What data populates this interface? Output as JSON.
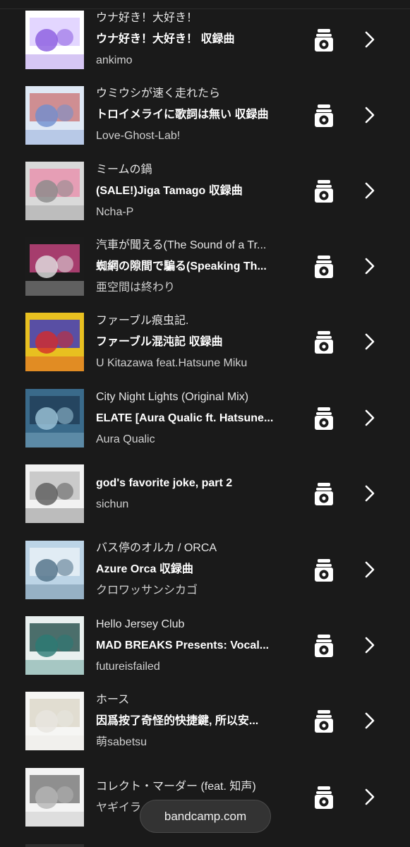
{
  "app": {
    "brand_pill": "bandcamp.com"
  },
  "feed": {
    "items": [
      {
        "title": "ウナ好き！大好き！",
        "album": "ウナ好き！大好き！ 収録曲",
        "artist": "ankimo",
        "art_colors": [
          "#ffffff",
          "#8a5be0",
          "#d9c8ff"
        ],
        "icon": "wishlist-icon"
      },
      {
        "title": "ウミウシが速く走れたら",
        "album": "トロイメライに歌詞は無い 収録曲",
        "artist": "Love-Ghost-Lab!",
        "art_colors": [
          "#dfe8f5",
          "#6f8fcf",
          "#c97070"
        ],
        "icon": "wishlist-icon"
      },
      {
        "title": "ミームの鍋",
        "album": "(SALE!)Jiga Tamago 収録曲",
        "artist": "Ncha-P",
        "art_colors": [
          "#d9d9d9",
          "#8a8a8a",
          "#e98aa8"
        ],
        "icon": "wishlist-icon"
      },
      {
        "title": "汽車が聞える(The Sound of a Tr...",
        "album": "蜘網の隙間で騙る(Speaking Th...",
        "artist": "亜空間は終わり",
        "art_colors": [
          "#1b1b1b",
          "#e2e2e2",
          "#d64a8a"
        ],
        "icon": "wishlist-icon"
      },
      {
        "title": "ファーブル痕虫記.",
        "album": "ファーブル混沌記 収録曲",
        "artist": "U Kitazawa feat.Hatsune Miku",
        "art_colors": [
          "#e8c020",
          "#d42a2a",
          "#2a2ad0"
        ],
        "icon": "wishlist-icon"
      },
      {
        "title": "City Night Lights (Original Mix)",
        "album": "ELATE [Aura Qualic ft. Hatsune...",
        "artist": "Aura Qualic",
        "art_colors": [
          "#3a6a8a",
          "#9fc6da",
          "#1f3a52"
        ],
        "icon": "wishlist-icon"
      },
      {
        "title": "",
        "album": "god's favorite joke, part 2",
        "artist": "sichun",
        "art_colors": [
          "#f2f2f2",
          "#5a5a5a",
          "#bcbcbc"
        ],
        "icon": "wishlist-icon"
      },
      {
        "title": "バス停のオルカ / ORCA",
        "album": "Azure Orca 収録曲",
        "artist": "クロワッサンシカゴ",
        "art_colors": [
          "#bcd4e6",
          "#4f6f86",
          "#eef4f8"
        ],
        "icon": "wishlist-icon"
      },
      {
        "title": "Hello Jersey Club",
        "album": "MAD BREAKS Presents: Vocal...",
        "artist": "futureisfailed",
        "art_colors": [
          "#e9f0ef",
          "#2a7a74",
          "#16433f"
        ],
        "icon": "wishlist-icon"
      },
      {
        "title": "ホース",
        "album": "因爲按了奇怪的快捷鍵, 所以安...",
        "artist": "萌sabetsu",
        "art_colors": [
          "#f6f6f4",
          "#e8e6e0",
          "#d9d4c6"
        ],
        "icon": "wishlist-icon"
      },
      {
        "title": "コレクト・マーダー (feat. 知声)",
        "album": "",
        "artist": "ヤギイラ",
        "art_colors": [
          "#f4f4f4",
          "#b5b5b5",
          "#6e6e6e"
        ],
        "icon": "wishlist-icon"
      }
    ]
  }
}
